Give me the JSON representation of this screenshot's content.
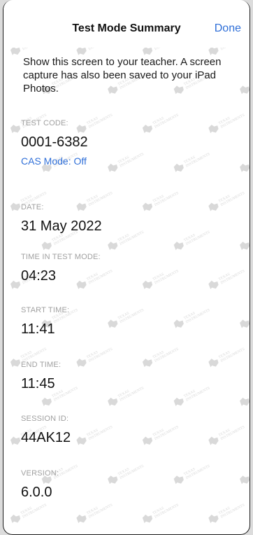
{
  "nav": {
    "title": "Test Mode Summary",
    "done_label": "Done"
  },
  "notice": "Show this screen to your teacher. A screen capture has also been saved to your iPad Photos.",
  "fields": {
    "test_code": {
      "label": "TEST CODE:",
      "value": "0001-6382",
      "cas_mode": "CAS Mode: Off"
    },
    "date": {
      "label": "DATE:",
      "value": "31 May 2022"
    },
    "time_in_test_mode": {
      "label": "TIME IN TEST MODE:",
      "value": "04:23"
    },
    "start_time": {
      "label": "START TIME:",
      "value": "11:41"
    },
    "end_time": {
      "label": "END TIME:",
      "value": "11:45"
    },
    "session_id": {
      "label": "SESSION ID:",
      "value": "44AK12"
    },
    "version": {
      "label": "VERSION:",
      "value": "6.0.0"
    }
  },
  "watermark": {
    "brand_line1": "TEXAS",
    "brand_line2": "INSTRUMENTS",
    "color": "#d9d9d9"
  },
  "colors": {
    "accent": "#2f6fd8",
    "label_gray": "#a0a0a0"
  }
}
